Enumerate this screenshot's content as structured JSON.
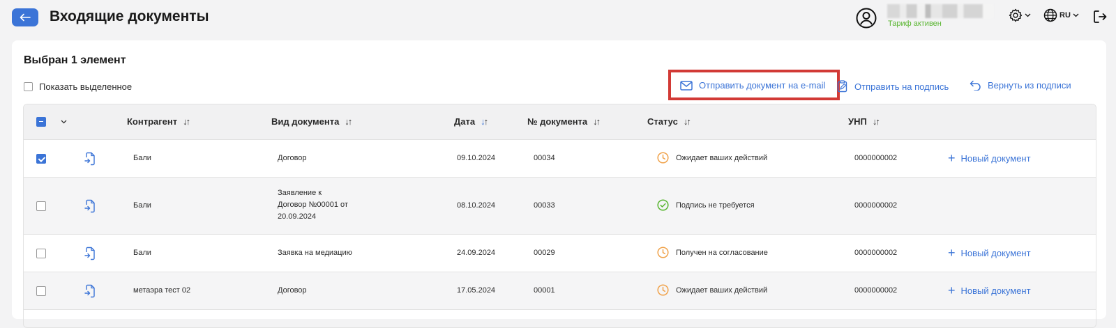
{
  "header": {
    "title": "Входящие документы",
    "tariff": "Тариф активен",
    "lang": "RU"
  },
  "toolbar": {
    "selected_title": "Выбран 1 элемент",
    "show_selected": "Показать выделенное",
    "send_email": "Отправить документ на e-mail",
    "send_sign": "Отправить на подпись",
    "return_sign": "Вернуть из подписи"
  },
  "table": {
    "columns": {
      "counterparty": "Контрагент",
      "doc_type": "Вид документа",
      "date": "Дата",
      "doc_number": "№ документа",
      "status": "Статус",
      "unp": "УНП"
    },
    "sort_arrows": "↓↑",
    "rows": [
      {
        "checked": true,
        "counterparty": "Бали",
        "doc_type": "Договор",
        "date": "09.10.2024",
        "doc_number": "00034",
        "status": "Ожидает ваших действий",
        "status_kind": "pending",
        "unp": "0000000002",
        "action": "Новый документ"
      },
      {
        "checked": false,
        "counterparty": "Бали",
        "doc_type_lines": [
          "Заявление к",
          "Договор №00001 от",
          "20.09.2024"
        ],
        "date": "08.10.2024",
        "doc_number": "00033",
        "status": "Подпись не требуется",
        "status_kind": "done",
        "unp": "0000000002"
      },
      {
        "checked": false,
        "counterparty": "Бали",
        "doc_type": "Заявка на медиацию",
        "date": "24.09.2024",
        "doc_number": "00029",
        "status": "Получен на согласование",
        "status_kind": "pending",
        "unp": "0000000002",
        "action": "Новый документ"
      },
      {
        "checked": false,
        "counterparty": "метаэра тест 02",
        "doc_type": "Договор",
        "date": "17.05.2024",
        "doc_number": "00001",
        "status": "Ожидает ваших действий",
        "status_kind": "pending",
        "unp": "0000000002",
        "action": "Новый документ"
      }
    ]
  },
  "colors": {
    "accent": "#3b74d7",
    "pending": "#f0a24a",
    "done": "#58b52f",
    "highlight": "#d23a36"
  }
}
